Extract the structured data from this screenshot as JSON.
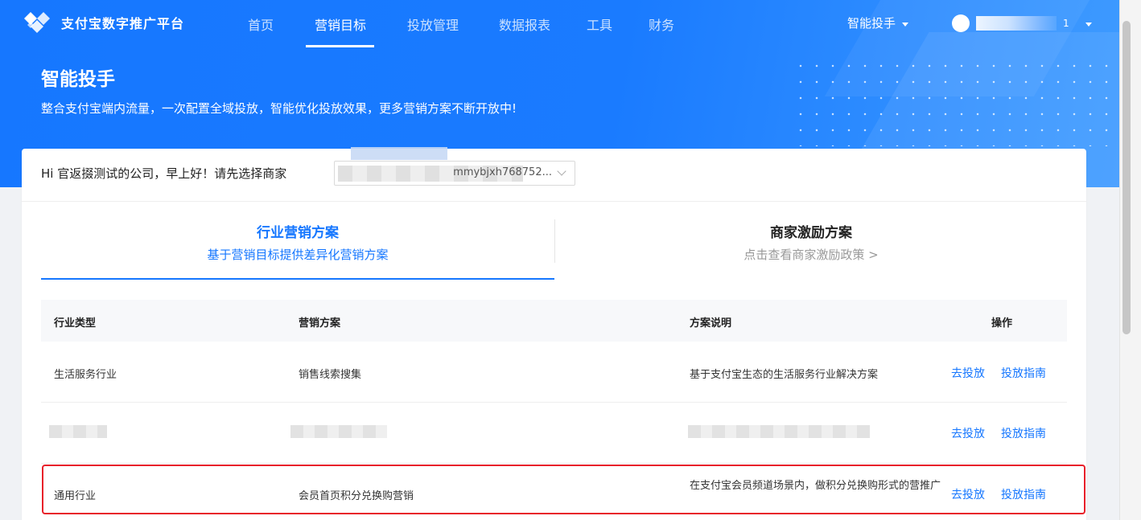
{
  "nav": {
    "brand": "支付宝数字推广平台",
    "items": [
      "首页",
      "营销目标",
      "投放管理",
      "数据报表",
      "工具",
      "财务"
    ],
    "active_index": 1,
    "assistant_menu": "智能投手",
    "user_suffix": "1"
  },
  "hero": {
    "title": "智能投手",
    "description": "整合支付宝端内流量，一次配置全域投放，智能优化投放效果，更多营销方案不断开放中!"
  },
  "merchant": {
    "greeting": "Hi 官返掇测试的公司，早上好！请先选择商家",
    "selected_value_visible": "mmybjxh768752..."
  },
  "tabs": [
    {
      "title": "行业营销方案",
      "subtitle": "基于营销目标提供差异化营销方案",
      "active": true
    },
    {
      "title": "商家激励方案",
      "subtitle": "点击查看商家激励政策 >",
      "active": false
    }
  ],
  "table": {
    "headers": [
      "行业类型",
      "营销方案",
      "方案说明",
      "操作"
    ],
    "rows": [
      {
        "industry": "生活服务行业",
        "plan": "销售线索搜集",
        "desc": "基于支付宝生态的生活服务行业解决方案",
        "action1": "去投放",
        "action2": "投放指南"
      },
      {
        "industry": "",
        "plan": "",
        "desc": "",
        "action1": "去投放",
        "action2": "投放指南"
      },
      {
        "industry": "通用行业",
        "plan": "会员首页积分兑换购营销",
        "desc": "在支付宝会员频道场景内，做积分兑换购形式的营推广",
        "action1": "去投放",
        "action2": "投放指南"
      }
    ]
  },
  "colors": {
    "primary": "#1677ff",
    "highlight": "#e8202a"
  }
}
